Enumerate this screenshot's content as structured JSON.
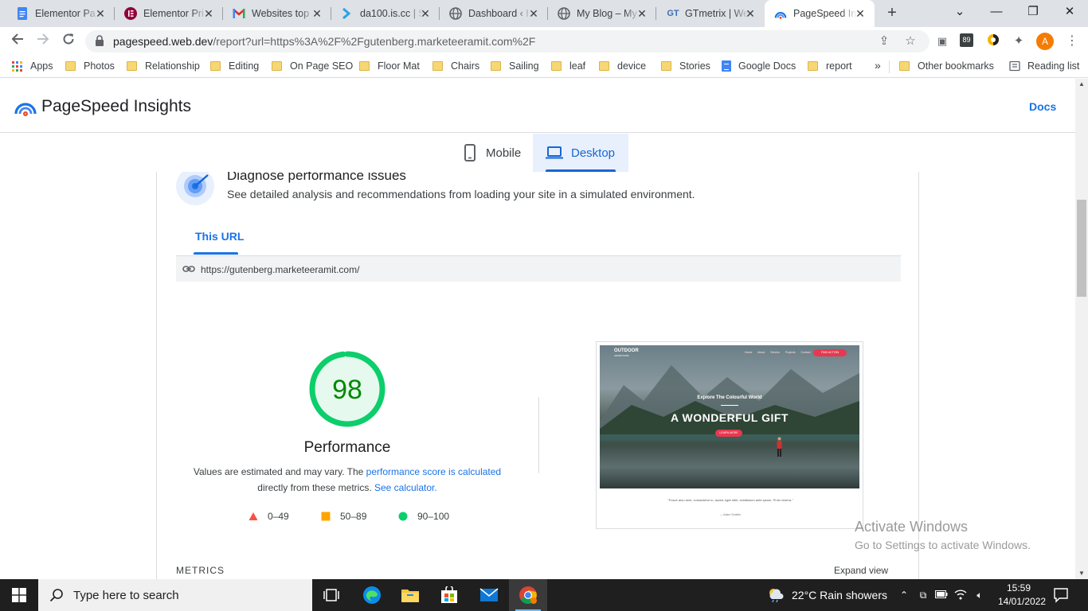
{
  "browser": {
    "tabs": [
      {
        "title": "Elementor Pa",
        "icon": "google-docs-icon",
        "active": false
      },
      {
        "title": "Elementor Pri",
        "icon": "elementor-icon",
        "active": false
      },
      {
        "title": "Websites top",
        "icon": "gmail-icon",
        "active": false
      },
      {
        "title": "da100.is.cc | S",
        "icon": "chevron-site-icon",
        "active": false
      },
      {
        "title": "Dashboard ‹ I",
        "icon": "globe-icon",
        "active": false
      },
      {
        "title": "My Blog – My",
        "icon": "globe-icon",
        "active": false
      },
      {
        "title": "GTmetrix | We",
        "icon": "gtmetrix-icon",
        "active": false
      },
      {
        "title": "PageSpeed In",
        "icon": "pagespeed-icon",
        "active": true
      }
    ],
    "url_host": "pagespeed.web.dev",
    "url_path": "/report?url=https%3A%2F%2Fgutenberg.marketeeramit.com%2F",
    "extension_badge": "89",
    "profile_initial": "A",
    "bookmarks": [
      {
        "label": "Apps",
        "type": "apps"
      },
      {
        "label": "Photos",
        "type": "folder"
      },
      {
        "label": "Relationship",
        "type": "folder"
      },
      {
        "label": "Editing",
        "type": "folder"
      },
      {
        "label": "On Page SEO",
        "type": "folder"
      },
      {
        "label": "Floor Mat",
        "type": "folder"
      },
      {
        "label": "Chairs",
        "type": "folder"
      },
      {
        "label": "Sailing",
        "type": "folder"
      },
      {
        "label": "leaf",
        "type": "folder"
      },
      {
        "label": "device",
        "type": "folder"
      },
      {
        "label": "Stories",
        "type": "folder"
      },
      {
        "label": "Google Docs",
        "type": "gdocs"
      },
      {
        "label": "report",
        "type": "folder"
      }
    ],
    "bookmarks_overflow": "»",
    "other_bookmarks": "Other bookmarks",
    "reading_list": "Reading list"
  },
  "page": {
    "app_title": "PageSpeed Insights",
    "docs_link": "Docs",
    "device_tabs": [
      {
        "label": "Mobile",
        "active": false
      },
      {
        "label": "Desktop",
        "active": true
      }
    ],
    "diagnose_title": "Diagnose performance issues",
    "diagnose_subtitle": "See detailed analysis and recommendations from loading your site in a simulated environment.",
    "url_tab": "This URL",
    "tested_url": "https://gutenberg.marketeeramit.com/",
    "score": {
      "value": 98,
      "label": "Performance",
      "color": "#0cce6b",
      "text_color": "#008800"
    },
    "desc_part1": "Values are estimated and may vary. The ",
    "desc_link1": "performance score is calculated",
    "desc_part2": "directly from these metrics. ",
    "desc_link2": "See calculator.",
    "legend": [
      {
        "range": "0–49",
        "shape": "triangle",
        "color": "#ff4e42"
      },
      {
        "range": "50–89",
        "shape": "square",
        "color": "#ffa400"
      },
      {
        "range": "90–100",
        "shape": "circle",
        "color": "#0cce6b"
      }
    ],
    "screenshot": {
      "logo_line1": "OUTDOOR",
      "logo_line2": "ADVENTURE",
      "menu": "Home About Service Projects Contact",
      "cta": "FIND ACTION",
      "explore": "Explore The Colourful World",
      "headline": "A WONDERFUL GIFT",
      "button": "LEARN MORE",
      "quote": "\"Fusce arcu sem, consectetur in, auctor eget nibh, vestibulum ante ipsum. Proin viverra.\"",
      "author": "— Adam Smaller"
    },
    "metrics_label": "METRICS",
    "expand_view": "Expand view"
  },
  "watermark": {
    "line1": "Activate Windows",
    "line2": "Go to Settings to activate Windows."
  },
  "taskbar": {
    "search_placeholder": "Type here to search",
    "weather": "22°C  Rain showers",
    "time": "15:59",
    "date": "14/01/2022"
  }
}
